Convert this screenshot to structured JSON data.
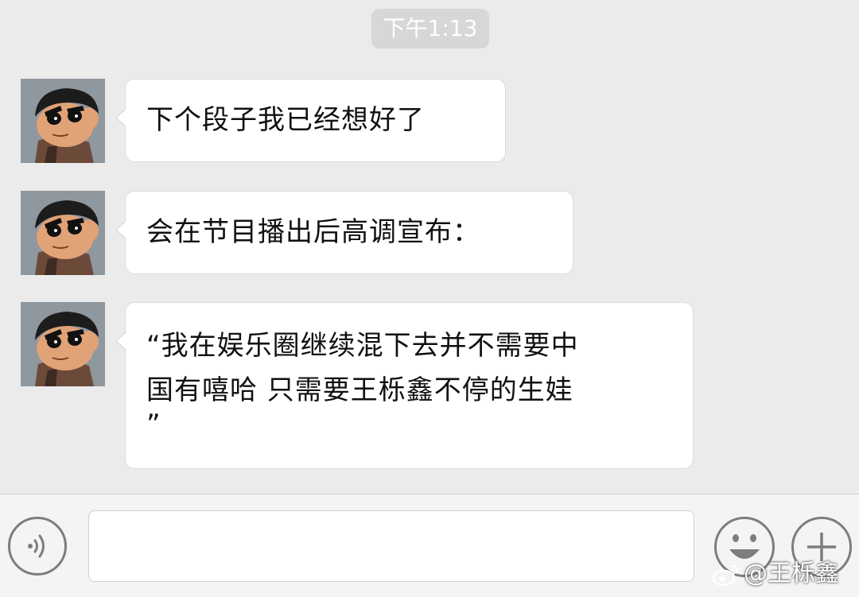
{
  "timestamp": "下午1:13",
  "messages": [
    {
      "text": "下个段子我已经想好了"
    },
    {
      "text": "会在节目播出后高调宣布："
    },
    {
      "line1": "“我在娱乐圈继续混下去并不需要中",
      "line2": "国有嘻哈 只需要王栎鑫不停的生娃",
      "line3": "”"
    }
  ],
  "input": {
    "value": "",
    "placeholder": ""
  },
  "icons": {
    "avatar": "cartoon-avatar-icon",
    "voice": "voice-icon",
    "emoji": "emoji-icon",
    "more": "plus-icon"
  },
  "watermark": {
    "text": "@王栎鑫"
  },
  "colors": {
    "background": "#ebebeb",
    "bubble": "#ffffff",
    "timestamp_bg": "#d7d7d7",
    "icon_stroke": "#7d7d7d"
  }
}
